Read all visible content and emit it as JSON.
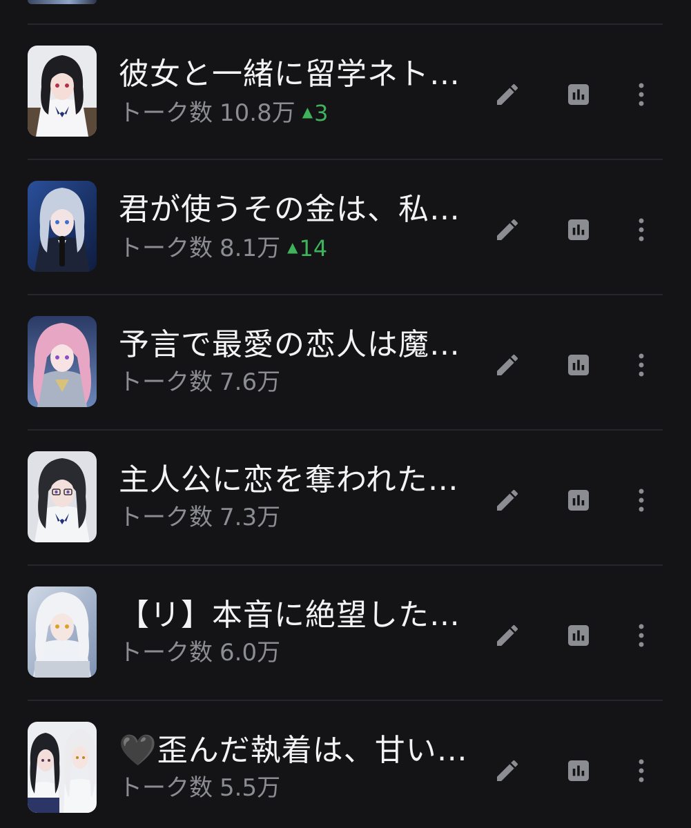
{
  "colors": {
    "background": "#141416",
    "divider": "#26272b",
    "title_text": "#f3f3f5",
    "meta_text": "#8c8d92",
    "trend_up": "#3fb25b",
    "icon": "#8c8d92"
  },
  "icons": {
    "edit": "pencil-icon",
    "stats": "bar-chart-icon",
    "more": "more-vertical-icon",
    "trend": "triangle-up-icon"
  },
  "items": [
    {
      "title": "彼女と一緒に留学ネト…",
      "meta_label": "トーク数",
      "count": "10.8万",
      "trend_arrow": "▲",
      "trend": "3",
      "avatar_hue": "dark-hair-school-uniform"
    },
    {
      "title": "君が使うその金は、私…",
      "meta_label": "トーク数",
      "count": "8.1万",
      "trend_arrow": "▲",
      "trend": "14",
      "avatar_hue": "silver-hair-suit"
    },
    {
      "title": "予言で最愛の恋人は魔…",
      "meta_label": "トーク数",
      "count": "7.6万",
      "trend_arrow": "",
      "trend": "",
      "avatar_hue": "pink-hair-armor"
    },
    {
      "title": "主人公に恋を奪われた…",
      "meta_label": "トーク数",
      "count": "7.3万",
      "trend_arrow": "",
      "trend": "",
      "avatar_hue": "dark-hair-glasses"
    },
    {
      "title": "【リ】本音に絶望した…",
      "meta_label": "トーク数",
      "count": "6.0万",
      "trend_arrow": "",
      "trend": "",
      "avatar_hue": "white-hair-studying"
    },
    {
      "title": "🖤歪んだ執着は、甘い…",
      "meta_label": "トーク数",
      "count": "5.5万",
      "trend_arrow": "",
      "trend": "",
      "avatar_hue": "two-girls"
    }
  ]
}
